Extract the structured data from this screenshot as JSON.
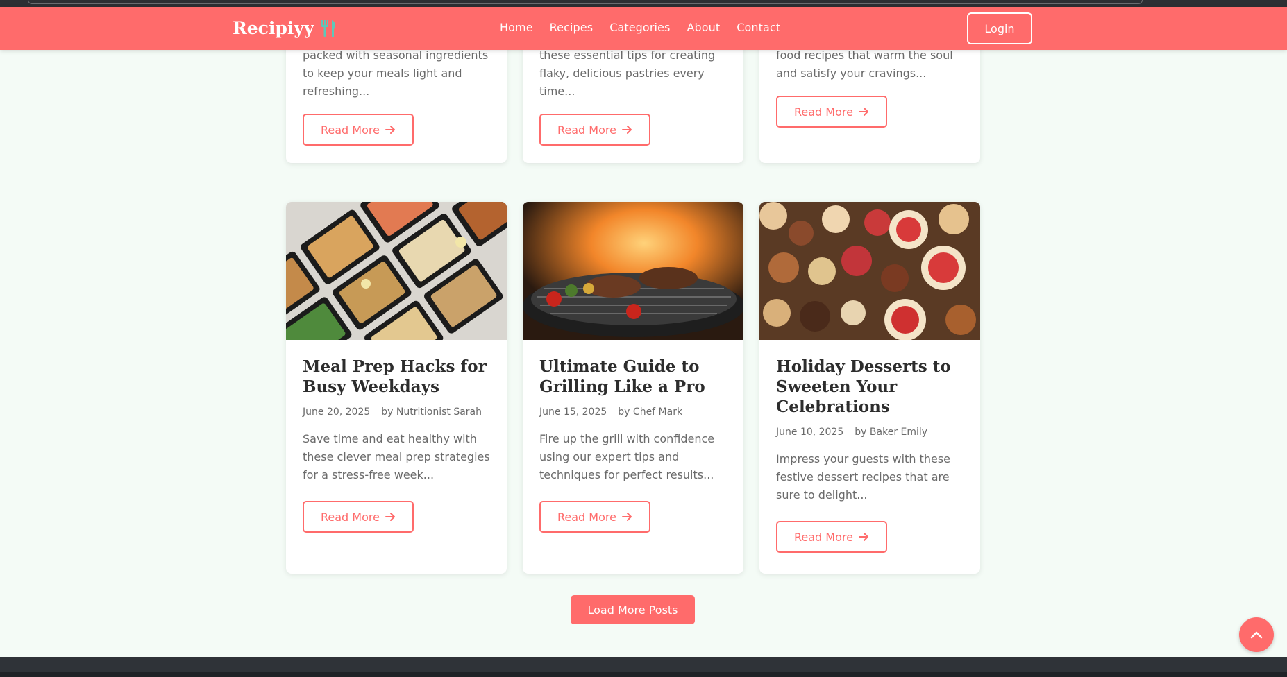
{
  "brand": {
    "name": "Recipiyy",
    "icon": "fork-knife-icon"
  },
  "nav": {
    "links": [
      "Home",
      "Recipes",
      "Categories",
      "About",
      "Contact"
    ],
    "login": "Login"
  },
  "colors": {
    "accent": "#ff6b6b",
    "background": "#f4fbf6",
    "text": "#2d2d2d",
    "muted": "#6a6a6a"
  },
  "top_cards": [
    {
      "excerpt": [
        "packed with seasonal ingredients",
        "to keep your meals light and",
        "refreshing..."
      ],
      "read_more": "Read More"
    },
    {
      "excerpt": [
        "these essential tips for creating",
        "flaky, delicious pastries every",
        "time..."
      ],
      "read_more": "Read More"
    },
    {
      "excerpt": [
        "food recipes that warm the soul",
        "and satisfy your cravings..."
      ],
      "read_more": "Read More"
    }
  ],
  "cards": [
    {
      "image": "meal-prep-containers-photo",
      "title": "Meal Prep Hacks for Busy Weekdays",
      "date": "June 20, 2025",
      "author": "by Nutritionist Sarah",
      "excerpt": "Save time and eat healthy with these clever meal prep strategies for a stress-free week...",
      "read_more": "Read More"
    },
    {
      "image": "grill-flames-photo",
      "title": "Ultimate Guide to Grilling Like a Pro",
      "date": "June 15, 2025",
      "author": "by Chef Mark",
      "excerpt": "Fire up the grill with confidence using our expert tips and techniques for perfect results...",
      "read_more": "Read More"
    },
    {
      "image": "holiday-desserts-photo",
      "title": "Holiday Desserts to Sweeten Your Celebrations",
      "date": "June 10, 2025",
      "author": "by Baker Emily",
      "excerpt": "Impress your guests with these festive dessert recipes that are sure to delight...",
      "read_more": "Read More"
    }
  ],
  "load_more": "Load More Posts",
  "scroll_top_icon": "chevron-up-icon"
}
